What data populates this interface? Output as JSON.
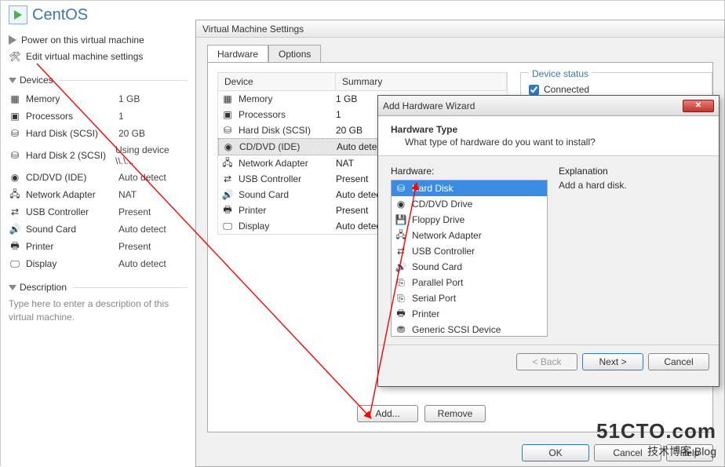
{
  "sidebar": {
    "vm_name": "CentOS",
    "power_on": "Power on this virtual machine",
    "edit_settings": "Edit virtual machine settings",
    "devices_header": "Devices",
    "devices": [
      {
        "name": "Memory",
        "value": "1 GB",
        "icon": "memory"
      },
      {
        "name": "Processors",
        "value": "1",
        "icon": "cpu"
      },
      {
        "name": "Hard Disk (SCSI)",
        "value": "20 GB",
        "icon": "hdd"
      },
      {
        "name": "Hard Disk 2 (SCSI)",
        "value": "Using device \\\\.\\...",
        "icon": "hdd"
      },
      {
        "name": "CD/DVD (IDE)",
        "value": "Auto detect",
        "icon": "cd"
      },
      {
        "name": "Network Adapter",
        "value": "NAT",
        "icon": "net"
      },
      {
        "name": "USB Controller",
        "value": "Present",
        "icon": "usb"
      },
      {
        "name": "Sound Card",
        "value": "Auto detect",
        "icon": "sound"
      },
      {
        "name": "Printer",
        "value": "Present",
        "icon": "printer"
      },
      {
        "name": "Display",
        "value": "Auto detect",
        "icon": "display"
      }
    ],
    "description_header": "Description",
    "description_placeholder": "Type here to enter a description of this virtual machine."
  },
  "settings": {
    "title": "Virtual Machine Settings",
    "tabs": {
      "hardware": "Hardware",
      "options": "Options"
    },
    "columns": {
      "device": "Device",
      "summary": "Summary"
    },
    "devices": [
      {
        "name": "Memory",
        "value": "1 GB",
        "icon": "memory"
      },
      {
        "name": "Processors",
        "value": "1",
        "icon": "cpu"
      },
      {
        "name": "Hard Disk (SCSI)",
        "value": "20 GB",
        "icon": "hdd"
      },
      {
        "name": "CD/DVD (IDE)",
        "value": "Auto detect",
        "icon": "cd",
        "selected": true
      },
      {
        "name": "Network Adapter",
        "value": "NAT",
        "icon": "net"
      },
      {
        "name": "USB Controller",
        "value": "Present",
        "icon": "usb"
      },
      {
        "name": "Sound Card",
        "value": "Auto detect",
        "icon": "sound"
      },
      {
        "name": "Printer",
        "value": "Present",
        "icon": "printer"
      },
      {
        "name": "Display",
        "value": "Auto detect",
        "icon": "display"
      }
    ],
    "status_group": "Device status",
    "connected": "Connected",
    "buttons": {
      "add": "Add...",
      "remove": "Remove",
      "ok": "OK",
      "cancel": "Cancel",
      "help": "Help"
    }
  },
  "wizard": {
    "title": "Add Hardware Wizard",
    "heading": "Hardware Type",
    "subheading": "What type of hardware do you want to install?",
    "hardware_label": "Hardware:",
    "explanation_label": "Explanation",
    "explanation_text": "Add a hard disk.",
    "items": [
      {
        "name": "Hard Disk",
        "icon": "hdd",
        "selected": true
      },
      {
        "name": "CD/DVD Drive",
        "icon": "cd"
      },
      {
        "name": "Floppy Drive",
        "icon": "floppy"
      },
      {
        "name": "Network Adapter",
        "icon": "net"
      },
      {
        "name": "USB Controller",
        "icon": "usb"
      },
      {
        "name": "Sound Card",
        "icon": "sound"
      },
      {
        "name": "Parallel Port",
        "icon": "port"
      },
      {
        "name": "Serial Port",
        "icon": "port"
      },
      {
        "name": "Printer",
        "icon": "printer"
      },
      {
        "name": "Generic SCSI Device",
        "icon": "scsi"
      }
    ],
    "buttons": {
      "back": "< Back",
      "next": "Next >",
      "cancel": "Cancel"
    }
  },
  "watermark": {
    "line1": "51CTO.com",
    "line2": "技术博客  Blog"
  }
}
